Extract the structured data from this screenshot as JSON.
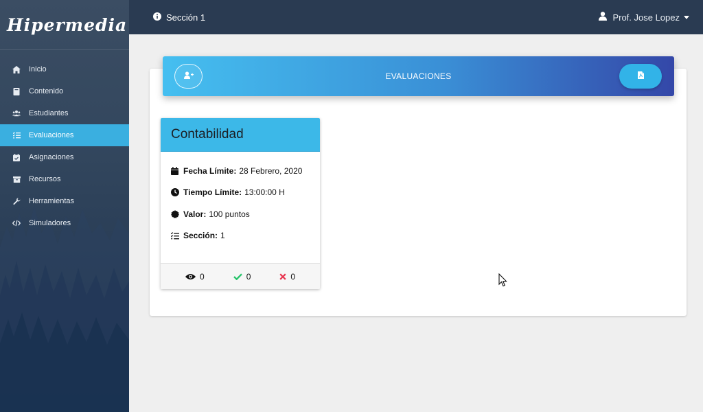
{
  "app": {
    "logo": "Hipermedia"
  },
  "sidebar": {
    "items": [
      {
        "label": "Inicio",
        "icon": "home-icon"
      },
      {
        "label": "Contenido",
        "icon": "book-icon"
      },
      {
        "label": "Estudiantes",
        "icon": "users-icon"
      },
      {
        "label": "Evaluaciones",
        "icon": "tasks-icon",
        "active": true
      },
      {
        "label": "Asignaciones",
        "icon": "calendar-check-icon"
      },
      {
        "label": "Recursos",
        "icon": "archive-icon"
      },
      {
        "label": "Herramientas",
        "icon": "wrench-icon"
      },
      {
        "label": "Simuladores",
        "icon": "code-icon"
      }
    ]
  },
  "topbar": {
    "section": "Sección 1",
    "user": "Prof. Jose Lopez"
  },
  "banner": {
    "title": "EVALUACIONES"
  },
  "card": {
    "title": "Contabilidad",
    "fields": [
      {
        "label": "Fecha Límite:",
        "value": "28 Febrero, 2020",
        "icon": "calendar-icon"
      },
      {
        "label": "Tiempo Límite:",
        "value": "13:00:00 H",
        "icon": "clock-icon"
      },
      {
        "label": "Valor:",
        "value": "100 puntos",
        "icon": "certificate-icon"
      },
      {
        "label": "Sección:",
        "value": "1",
        "icon": "list-check-icon"
      }
    ],
    "stats": {
      "views": "0",
      "approved": "0",
      "failed": "0"
    }
  },
  "colors": {
    "accent": "#3aafe0",
    "sidebar": "#2a3e57",
    "topbar": "#2a3b52",
    "success": "#27c46b",
    "danger": "#e8344e"
  }
}
